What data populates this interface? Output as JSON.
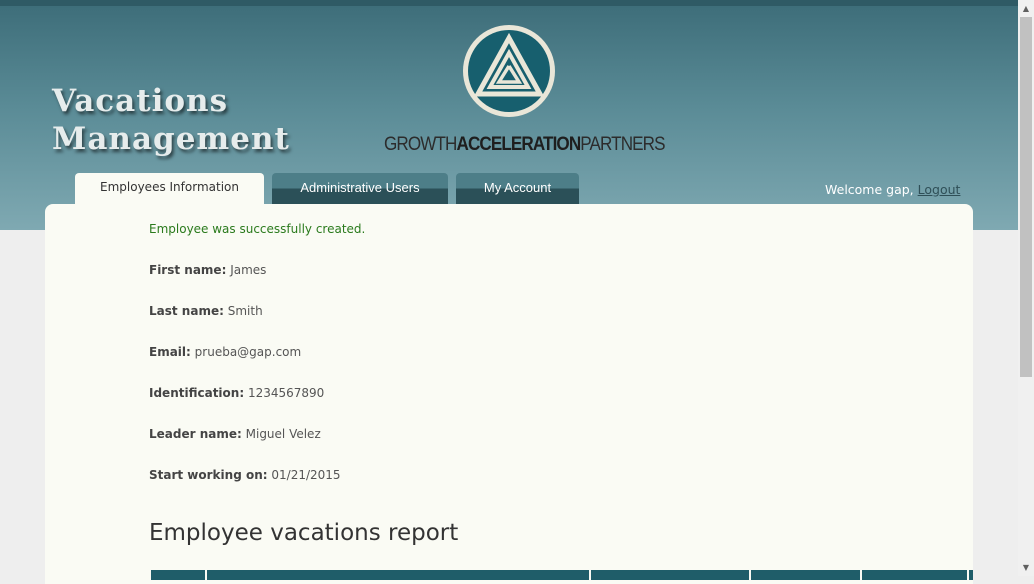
{
  "app": {
    "title_line1": "Vacations",
    "title_line2": "Management"
  },
  "brand": {
    "word1": "GROWTH",
    "word2": "ACCELERATION",
    "word3": "PARTNERS"
  },
  "nav": {
    "tabs": [
      {
        "label": "Employees Information",
        "active": true
      },
      {
        "label": "Administrative Users",
        "active": false
      },
      {
        "label": "My Account",
        "active": false
      }
    ]
  },
  "user": {
    "welcome": "Welcome gap,",
    "logout": "Logout"
  },
  "employee": {
    "notice": "Employee was successfully created.",
    "fields": [
      {
        "label": "First name:",
        "value": "James"
      },
      {
        "label": "Last name:",
        "value": "Smith"
      },
      {
        "label": "Email:",
        "value": "prueba@gap.com"
      },
      {
        "label": "Identification:",
        "value": "1234567890"
      },
      {
        "label": "Leader name:",
        "value": "Miguel Velez"
      },
      {
        "label": "Start working on:",
        "value": "01/21/2015"
      }
    ]
  },
  "report": {
    "title": "Employee vacations report"
  },
  "colors": {
    "header": "#5a8b96",
    "tab_dark": "#2b5058",
    "success": "#2a7a1c",
    "table_head": "#1f5d69"
  }
}
